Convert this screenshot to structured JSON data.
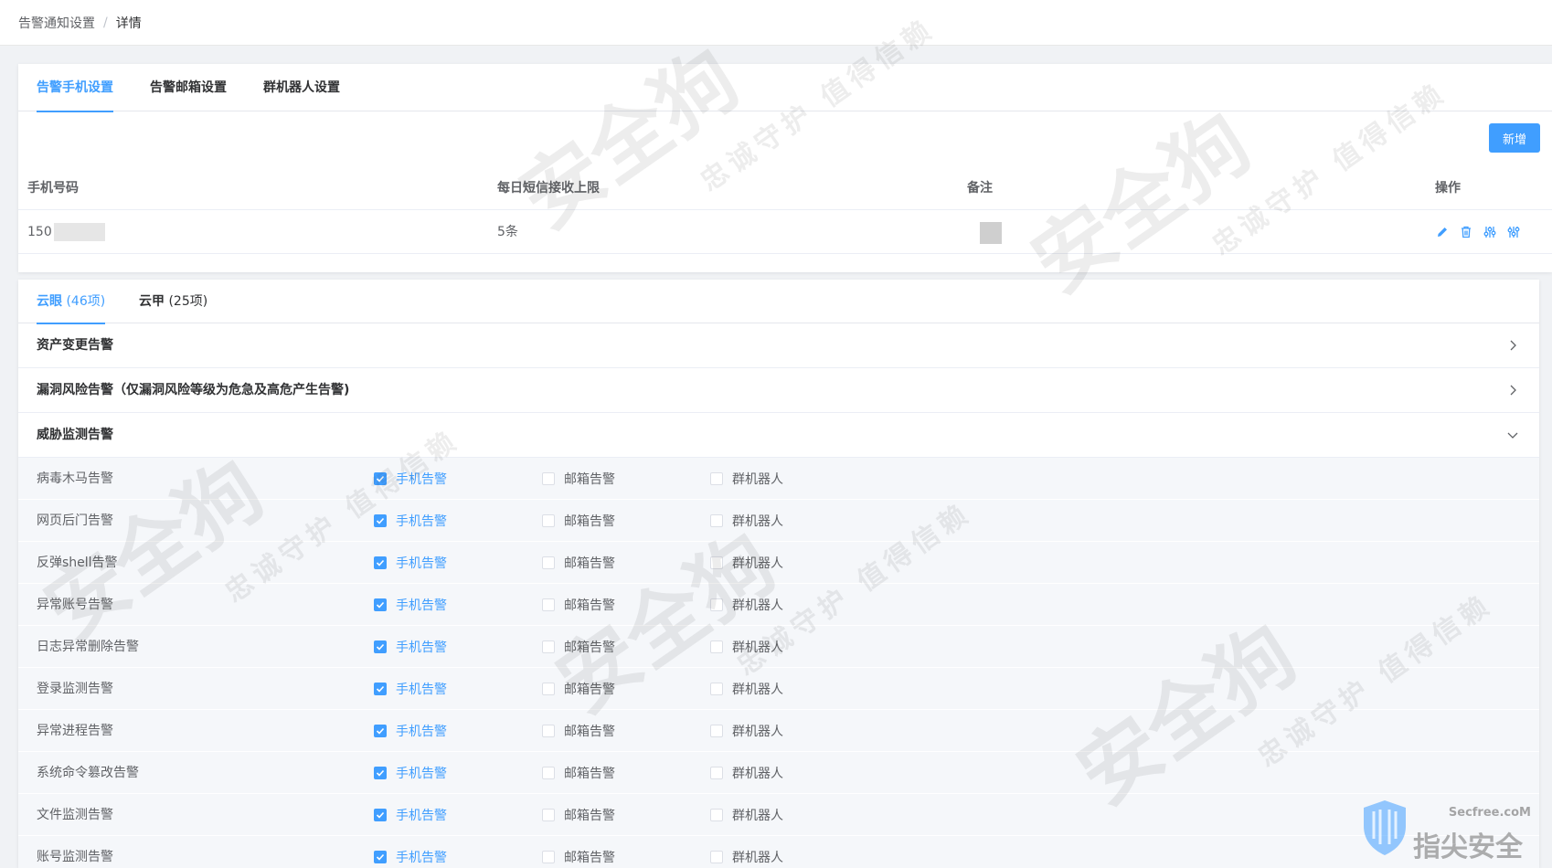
{
  "breadcrumb": {
    "parent": "告警通知设置",
    "separator": "/",
    "current": "详情"
  },
  "tabs": [
    {
      "label": "告警手机设置",
      "active": true
    },
    {
      "label": "告警邮箱设置",
      "active": false
    },
    {
      "label": "群机器人设置",
      "active": false
    }
  ],
  "add_button": "新增",
  "table": {
    "headers": [
      "手机号码",
      "每日短信接收上限",
      "备注",
      "操作"
    ],
    "rows": [
      {
        "phone": "150",
        "limit": "5条",
        "remark": ""
      }
    ]
  },
  "category_tabs": [
    {
      "label": "云眼",
      "count": "(46项)",
      "active": true
    },
    {
      "label": "云甲",
      "count": "(25项)",
      "active": false
    }
  ],
  "sections": [
    {
      "title": "资产变更告警",
      "expanded": false
    },
    {
      "title": "漏洞风险告警（仅漏洞风险等级为危急及高危产生告警)",
      "expanded": false
    },
    {
      "title": "威胁监测告警",
      "expanded": true
    }
  ],
  "channel_labels": {
    "sms": "手机告警",
    "email": "邮箱告警",
    "robot": "群机器人"
  },
  "alerts": [
    {
      "name": "病毒木马告警",
      "sms": true,
      "email": false,
      "robot": false
    },
    {
      "name": "网页后门告警",
      "sms": true,
      "email": false,
      "robot": false
    },
    {
      "name": "反弹shell告警",
      "sms": true,
      "email": false,
      "robot": false
    },
    {
      "name": "异常账号告警",
      "sms": true,
      "email": false,
      "robot": false
    },
    {
      "name": "日志异常删除告警",
      "sms": true,
      "email": false,
      "robot": false
    },
    {
      "name": "登录监测告警",
      "sms": true,
      "email": false,
      "robot": false
    },
    {
      "name": "异常进程告警",
      "sms": true,
      "email": false,
      "robot": false
    },
    {
      "name": "系统命令篡改告警",
      "sms": true,
      "email": false,
      "robot": false
    },
    {
      "name": "文件监测告警",
      "sms": true,
      "email": false,
      "robot": false
    },
    {
      "name": "账号监测告警",
      "sms": true,
      "email": false,
      "robot": false
    }
  ],
  "watermark": {
    "main": "安全狗",
    "slogan": "忠诚守护 值得信赖"
  },
  "brand": {
    "url": "Secfree.coM",
    "name": "指尖安全"
  },
  "colors": {
    "accent": "#409eff",
    "row_bg": "#f5f7fa"
  }
}
